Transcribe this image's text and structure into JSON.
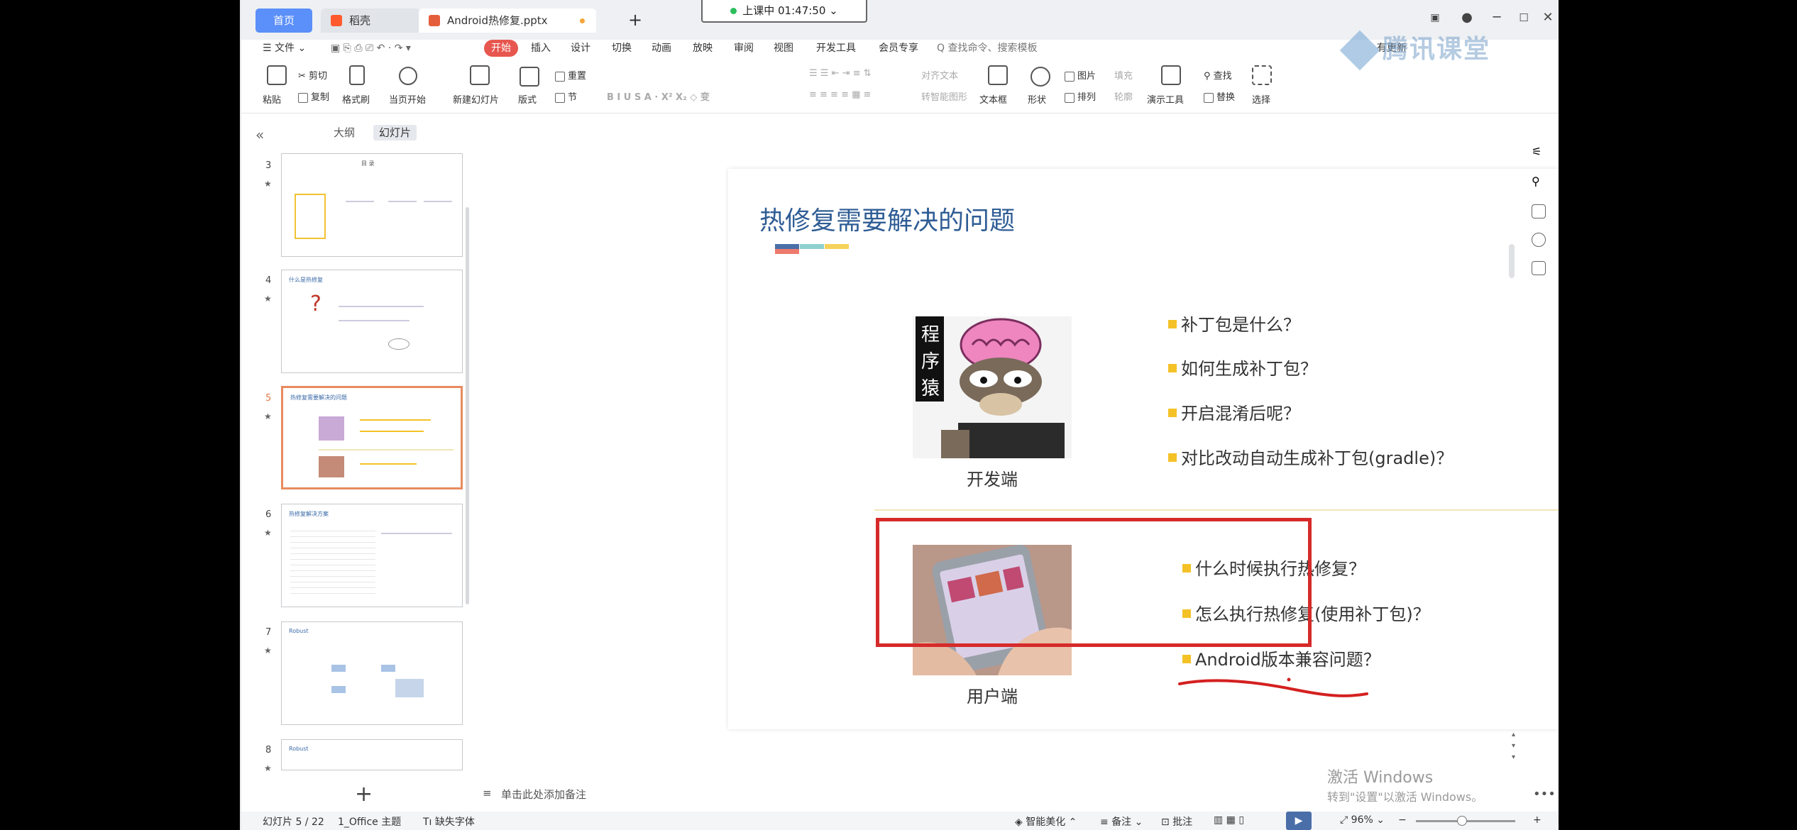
{
  "tabs": {
    "home": "首页",
    "docer": "稻壳",
    "doc": "Android热修复.pptx",
    "add": "+"
  },
  "live": {
    "status": "上课中 01:47:50",
    "arrow": "⌄"
  },
  "window": {
    "minimize": "─",
    "maximize": "☐",
    "close": "✕"
  },
  "menu": {
    "file": "☰ 文件 ⌄",
    "items": [
      "开始",
      "插入",
      "设计",
      "切换",
      "动画",
      "放映",
      "审阅",
      "视图",
      "开发工具",
      "会员专享"
    ],
    "search": "Q 查找命令、搜索模板",
    "update": "有更新"
  },
  "watermark_logo": "腾讯课堂",
  "ribbon": {
    "paste": "粘贴",
    "cut": "剪切",
    "copy": "复制",
    "format_painter": "格式刷",
    "from_current": "当页开始",
    "new_slide": "新建幻灯片",
    "layout": "版式",
    "reset": "重置",
    "section": "节",
    "align_text": "对齐文本",
    "convert_shape": "转智能图形",
    "textbox": "文本框",
    "shape": "形状",
    "picture": "图片",
    "arrange": "排列",
    "fill": "填充",
    "outline": "轮廓",
    "present_tools": "演示工具",
    "find": "查找",
    "replace": "替换",
    "select": "选择"
  },
  "panel": {
    "collapse": "«",
    "tab_outline": "大纲",
    "tab_slides": "幻灯片",
    "slide_numbers": [
      "3",
      "4",
      "5",
      "6",
      "7",
      "8"
    ],
    "add_slide": "+",
    "thumb_titles": [
      "目 录",
      "什么是热修复",
      "热修复需要解决的问题",
      "热修复解决方案",
      "Robust",
      "Robust"
    ]
  },
  "slide": {
    "title": "热修复需要解决的问题",
    "dev_caption": "开发端",
    "user_caption": "用户端",
    "dev_bullets": [
      "补丁包是什么？",
      "如何生成补丁包？",
      "开启混淆后呢？",
      "对比改动自动生成补丁包(gradle)？"
    ],
    "user_bullets": [
      "什么时候执行热修复？",
      "怎么执行热修复(使用补丁包)？",
      "Android版本兼容问题？"
    ],
    "monkey_label": "程序猿",
    "colors": {
      "title": "#2f5d95",
      "bullet": "#f4c227",
      "red_box": "#d62a2a"
    }
  },
  "win_watermark": {
    "line1": "激活 Windows",
    "line2": "转到\"设置\"以激活 Windows。"
  },
  "notes_placeholder": "单击此处添加备注",
  "status": {
    "slide_info": "幻灯片 5 / 22",
    "theme": "1_Office 主题",
    "missing_font": "缺失字体",
    "beautify": "智能美化",
    "notes": "备注",
    "comments": "批注",
    "zoom": "96%",
    "zoom_minus": "−",
    "zoom_plus": "+"
  }
}
